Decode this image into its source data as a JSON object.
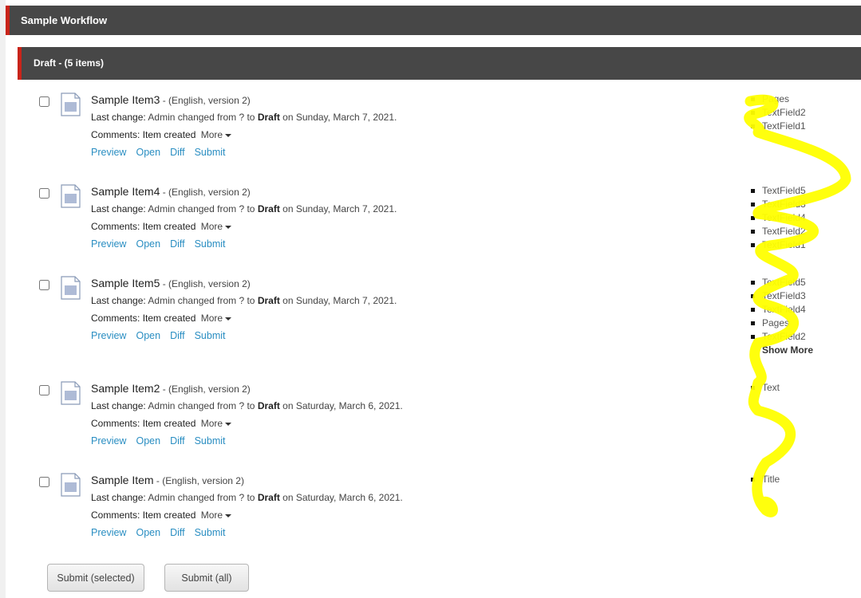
{
  "workflow": {
    "title": "Sample Workflow"
  },
  "state": {
    "header": "Draft - (5 items)"
  },
  "labels": {
    "last_change_prefix": "Last change:",
    "changed_mid": "Admin changed from ? to",
    "comments_prefix": "Comments:",
    "more": "More",
    "show_more": "Show More"
  },
  "items": [
    {
      "name": "Sample Item3",
      "meta": " - (English, version 2)",
      "target_state": "Draft",
      "date": " on Sunday, March 7, 2021.",
      "comment": "Item created",
      "fields": [
        "Pages",
        "TextField2",
        "TextField1"
      ]
    },
    {
      "name": "Sample Item4",
      "meta": " - (English, version 2)",
      "target_state": "Draft",
      "date": " on Sunday, March 7, 2021.",
      "comment": "Item created",
      "fields": [
        "TextField5",
        "TextField3",
        "TextField4",
        "TextField2",
        "TextField1"
      ]
    },
    {
      "name": "Sample Item5",
      "meta": " - (English, version 2)",
      "target_state": "Draft",
      "date": " on Sunday, March 7, 2021.",
      "comment": "Item created",
      "fields": [
        "TextField5",
        "TextField3",
        "TextField4",
        "Pages",
        "TextField2"
      ]
    },
    {
      "name": "Sample Item2",
      "meta": " - (English, version 2)",
      "target_state": "Draft",
      "date": " on Saturday, March 6, 2021.",
      "comment": "Item created",
      "fields": [
        "Text"
      ]
    },
    {
      "name": "Sample Item",
      "meta": " - (English, version 2)",
      "target_state": "Draft",
      "date": " on Saturday, March 6, 2021.",
      "comment": "Item created",
      "fields": [
        "Title"
      ]
    }
  ],
  "actions": {
    "preview": "Preview",
    "open": "Open",
    "diff": "Diff",
    "submit": "Submit"
  },
  "buttons": {
    "submit_selected": "Submit (selected)",
    "submit_all": "Submit (all)"
  },
  "colors": {
    "header_bg": "#474747",
    "accent": "#c9241a",
    "link": "#2a8ec2",
    "highlight": "#ffff00"
  }
}
